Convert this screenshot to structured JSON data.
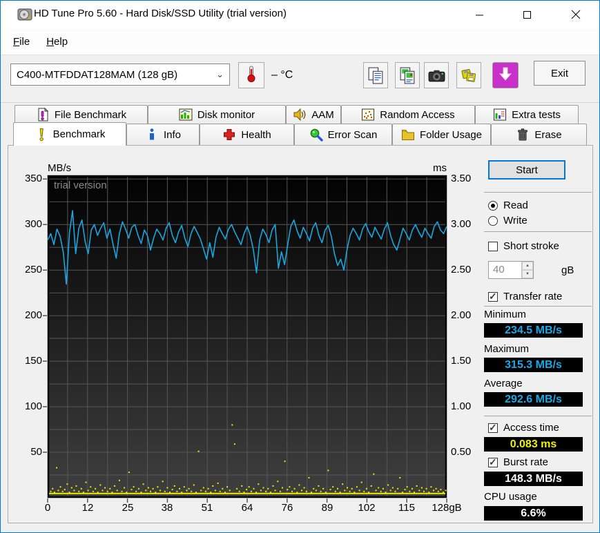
{
  "window": {
    "title": "HD Tune Pro 5.60 - Hard Disk/SSD Utility (trial version)"
  },
  "menu": {
    "items": [
      {
        "label": "File"
      },
      {
        "label": "Help"
      }
    ]
  },
  "toolbar": {
    "drive_selector": {
      "value": "C400-MTFDDAT128MAM (128 gB)"
    },
    "temperature": {
      "value": "–",
      "unit": "°C"
    },
    "buttons": [
      {
        "icon": "copy-text"
      },
      {
        "icon": "copy-image"
      },
      {
        "icon": "screenshot"
      },
      {
        "icon": "save"
      }
    ],
    "exit_label": "Exit"
  },
  "tabs": {
    "row1": [
      {
        "label": "File Benchmark",
        "icon": "file-benchmark"
      },
      {
        "label": "Disk monitor",
        "icon": "disk-monitor"
      },
      {
        "label": "AAM",
        "icon": "aam"
      },
      {
        "label": "Random Access",
        "icon": "random-access"
      },
      {
        "label": "Extra tests",
        "icon": "extra-tests"
      }
    ],
    "row2": [
      {
        "label": "Benchmark",
        "icon": "benchmark",
        "active": true
      },
      {
        "label": "Info",
        "icon": "info"
      },
      {
        "label": "Health",
        "icon": "health"
      },
      {
        "label": "Error Scan",
        "icon": "error-scan"
      },
      {
        "label": "Folder Usage",
        "icon": "folder-usage"
      },
      {
        "label": "Erase",
        "icon": "erase"
      }
    ]
  },
  "panel": {
    "start_label": "Start",
    "read_label": "Read",
    "write_label": "Write",
    "mode_selected": "Read",
    "short_stroke_label": "Short stroke",
    "short_stroke_checked": false,
    "short_stroke_size": "40",
    "short_stroke_unit": "gB",
    "transfer_rate": {
      "label": "Transfer rate",
      "checked": true,
      "minimum_label": "Minimum",
      "minimum": "234.5 MB/s",
      "maximum_label": "Maximum",
      "maximum": "315.3 MB/s",
      "average_label": "Average",
      "average": "292.6 MB/s"
    },
    "access_time": {
      "label": "Access time",
      "checked": true,
      "value": "0.083 ms"
    },
    "burst_rate": {
      "label": "Burst rate",
      "checked": true,
      "value": "148.3 MB/s"
    },
    "cpu_usage": {
      "label": "CPU usage",
      "value": "6.6%"
    }
  },
  "chart_data": {
    "type": "line",
    "title": "",
    "watermark": "trial version",
    "grid": true,
    "left_axis": {
      "label": "MB/s",
      "min": 0,
      "max": 354,
      "ticks": [
        "350",
        "300",
        "250",
        "200",
        "150",
        "100",
        "50"
      ],
      "tick_values": [
        350,
        300,
        250,
        200,
        150,
        100,
        50
      ],
      "grid_step": 25
    },
    "right_axis": {
      "label": "ms",
      "ticks": [
        "3.50",
        "3.00",
        "2.50",
        "2.00",
        "1.50",
        "1.00",
        "0.50"
      ],
      "tick_values": [
        3.5,
        3.0,
        2.5,
        2.0,
        1.5,
        1.0,
        0.5
      ]
    },
    "x_axis": {
      "min": 0,
      "max": 128,
      "labels": [
        "0",
        "12",
        "25",
        "38",
        "51",
        "64",
        "76",
        "89",
        "102",
        "115",
        "128gB"
      ],
      "label_step_gb": 12.8,
      "grid_step_gb": 6.4
    },
    "colors": {
      "line": "#18a7e0",
      "scatter": "#eded00",
      "grid": "#575757",
      "bg_top": "#020202",
      "bg_bottom": "#3f3f3f",
      "watermark": "#8a8a8a"
    },
    "series": [
      {
        "name": "Transfer rate",
        "unit": "MB/s",
        "type": "line",
        "x_start_gb": 0,
        "x_step_gb": 1,
        "values": [
          283,
          290,
          278,
          295,
          287,
          270,
          234.5,
          291,
          315.3,
          268,
          296,
          305,
          282,
          268,
          294,
          300,
          288,
          296,
          302,
          285,
          295,
          278,
          263,
          290,
          303,
          295,
          285,
          297,
          300,
          288,
          279,
          294,
          288,
          272,
          285,
          295,
          290,
          283,
          296,
          302,
          288,
          280,
          292,
          299,
          285,
          276,
          290,
          298,
          291,
          284,
          273,
          262,
          280,
          264,
          286,
          297,
          290,
          284,
          295,
          300,
          292,
          285,
          278,
          290,
          298,
          288,
          272,
          247,
          283,
          295,
          289,
          280,
          294,
          300,
          252,
          270,
          256,
          278,
          298,
          305,
          293,
          285,
          297,
          290,
          282,
          296,
          302,
          288,
          280,
          294,
          299,
          287,
          268,
          255,
          262,
          250,
          272,
          288,
          296,
          290,
          283,
          295,
          301,
          292,
          286,
          297,
          290,
          284,
          295,
          302,
          288,
          278,
          272,
          284,
          296,
          290,
          283,
          294,
          300,
          292,
          286,
          296,
          290,
          285,
          298,
          303,
          294,
          290,
          298
        ]
      },
      {
        "name": "Access time",
        "unit": "ms",
        "type": "scatter",
        "baseline_ms": 0.048,
        "points": [
          [
            1,
            0.07
          ],
          [
            1.6,
            0.1
          ],
          [
            2.2,
            0.06
          ],
          [
            2.9,
            0.33
          ],
          [
            3.4,
            0.08
          ],
          [
            4.1,
            0.12
          ],
          [
            4.8,
            0.07
          ],
          [
            5.5,
            0.09
          ],
          [
            6.3,
            0.15
          ],
          [
            7,
            0.06
          ],
          [
            7.7,
            0.11
          ],
          [
            8.5,
            0.08
          ],
          [
            9.2,
            0.13
          ],
          [
            10,
            0.07
          ],
          [
            10.8,
            0.1
          ],
          [
            11.5,
            0.06
          ],
          [
            12.3,
            0.17
          ],
          [
            13,
            0.08
          ],
          [
            13.8,
            0.12
          ],
          [
            14.6,
            0.07
          ],
          [
            15.3,
            0.1
          ],
          [
            16.1,
            0.06
          ],
          [
            16.9,
            0.14
          ],
          [
            17.6,
            0.08
          ],
          [
            18.4,
            0.11
          ],
          [
            19.2,
            0.07
          ],
          [
            20,
            0.1
          ],
          [
            20.7,
            0.06
          ],
          [
            21.5,
            0.13
          ],
          [
            22.3,
            0.08
          ],
          [
            23,
            0.19
          ],
          [
            23.8,
            0.07
          ],
          [
            24.6,
            0.11
          ],
          [
            25.3,
            0.06
          ],
          [
            26.1,
            0.28
          ],
          [
            26.9,
            0.09
          ],
          [
            27.6,
            0.12
          ],
          [
            28.4,
            0.07
          ],
          [
            29.2,
            0.1
          ],
          [
            30,
            0.06
          ],
          [
            30.7,
            0.15
          ],
          [
            31.5,
            0.08
          ],
          [
            32.3,
            0.11
          ],
          [
            33,
            0.07
          ],
          [
            33.8,
            0.1
          ],
          [
            34.6,
            0.06
          ],
          [
            35.3,
            0.12
          ],
          [
            36.1,
            0.08
          ],
          [
            36.9,
            0.18
          ],
          [
            37.6,
            0.07
          ],
          [
            38.4,
            0.11
          ],
          [
            39.2,
            0.06
          ],
          [
            40,
            0.09
          ],
          [
            40.7,
            0.13
          ],
          [
            41.5,
            0.07
          ],
          [
            42.3,
            0.1
          ],
          [
            43,
            0.06
          ],
          [
            43.8,
            0.12
          ],
          [
            44.6,
            0.08
          ],
          [
            45.3,
            0.1
          ],
          [
            46.1,
            0.07
          ],
          [
            46.9,
            0.14
          ],
          [
            47.6,
            0.06
          ],
          [
            48.4,
            0.51
          ],
          [
            49.2,
            0.08
          ],
          [
            50,
            0.11
          ],
          [
            50.7,
            0.07
          ],
          [
            51.5,
            0.1
          ],
          [
            52.3,
            0.06
          ],
          [
            53,
            0.13
          ],
          [
            53.8,
            0.08
          ],
          [
            54.6,
            0.16
          ],
          [
            55.3,
            0.07
          ],
          [
            56.1,
            0.1
          ],
          [
            56.9,
            0.06
          ],
          [
            57.6,
            0.12
          ],
          [
            58.4,
            0.08
          ],
          [
            59.2,
            0.8
          ],
          [
            60,
            0.59
          ],
          [
            60.7,
            0.1
          ],
          [
            61.5,
            0.07
          ],
          [
            62.3,
            0.13
          ],
          [
            63,
            0.06
          ],
          [
            63.8,
            0.09
          ],
          [
            64.6,
            0.12
          ],
          [
            65.3,
            0.07
          ],
          [
            66.1,
            0.1
          ],
          [
            66.9,
            0.06
          ],
          [
            67.6,
            0.15
          ],
          [
            68.4,
            0.08
          ],
          [
            69.2,
            0.11
          ],
          [
            70,
            0.07
          ],
          [
            70.7,
            0.1
          ],
          [
            71.5,
            0.06
          ],
          [
            72.3,
            0.13
          ],
          [
            73,
            0.08
          ],
          [
            73.8,
            0.18
          ],
          [
            74.6,
            0.07
          ],
          [
            75.3,
            0.11
          ],
          [
            76.1,
            0.4
          ],
          [
            76.9,
            0.09
          ],
          [
            77.6,
            0.12
          ],
          [
            78.4,
            0.07
          ],
          [
            79.2,
            0.1
          ],
          [
            80,
            0.06
          ],
          [
            80.7,
            0.14
          ],
          [
            81.5,
            0.08
          ],
          [
            82.3,
            0.11
          ],
          [
            83,
            0.07
          ],
          [
            83.8,
            0.22
          ],
          [
            84.6,
            0.06
          ],
          [
            85.3,
            0.1
          ],
          [
            86.1,
            0.08
          ],
          [
            86.9,
            0.13
          ],
          [
            87.6,
            0.07
          ],
          [
            88.4,
            0.1
          ],
          [
            89.2,
            0.06
          ],
          [
            90,
            0.3
          ],
          [
            90.7,
            0.09
          ],
          [
            91.5,
            0.12
          ],
          [
            92.3,
            0.07
          ],
          [
            93,
            0.1
          ],
          [
            93.8,
            0.06
          ],
          [
            94.6,
            0.15
          ],
          [
            95.3,
            0.08
          ],
          [
            96.1,
            0.11
          ],
          [
            96.9,
            0.07
          ],
          [
            97.6,
            0.1
          ],
          [
            98.4,
            0.06
          ],
          [
            99.2,
            0.12
          ],
          [
            100,
            0.08
          ],
          [
            100.7,
            0.17
          ],
          [
            101.5,
            0.07
          ],
          [
            102.3,
            0.1
          ],
          [
            103,
            0.06
          ],
          [
            103.8,
            0.13
          ],
          [
            104.6,
            0.26
          ],
          [
            105.3,
            0.08
          ],
          [
            106.1,
            0.11
          ],
          [
            106.9,
            0.07
          ],
          [
            107.6,
            0.1
          ],
          [
            108.4,
            0.06
          ],
          [
            109.2,
            0.14
          ],
          [
            110,
            0.08
          ],
          [
            110.7,
            0.11
          ],
          [
            111.5,
            0.07
          ],
          [
            112.3,
            0.1
          ],
          [
            113,
            0.22
          ],
          [
            113.8,
            0.06
          ],
          [
            114.6,
            0.09
          ],
          [
            115.3,
            0.12
          ],
          [
            116.1,
            0.07
          ],
          [
            116.9,
            0.1
          ],
          [
            117.6,
            0.06
          ],
          [
            118.4,
            0.13
          ],
          [
            119.2,
            0.08
          ],
          [
            120,
            0.11
          ],
          [
            120.7,
            0.07
          ],
          [
            121.5,
            0.1
          ],
          [
            122.3,
            0.06
          ],
          [
            123,
            0.12
          ],
          [
            123.8,
            0.08
          ],
          [
            124.6,
            0.1
          ],
          [
            125.3,
            0.07
          ],
          [
            126.1,
            0.09
          ],
          [
            126.9,
            0.06
          ],
          [
            127.7,
            0.08
          ]
        ]
      }
    ]
  }
}
